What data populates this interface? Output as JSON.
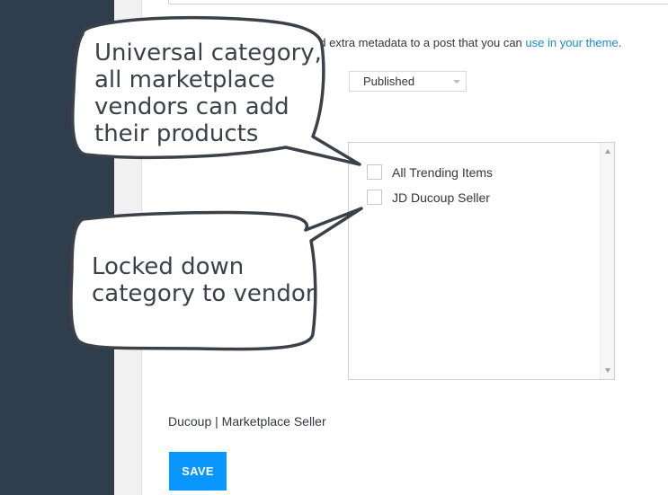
{
  "colors": {
    "sidebar": "#2f3d4c",
    "link": "#1e88d6",
    "save_button": "#0a96ff",
    "callout_border": "#3b4148"
  },
  "metadata_hint": {
    "prefix": "o add extra metadata to a post that you can ",
    "link": "use in your theme",
    "suffix": "."
  },
  "status_select": {
    "value": "Published",
    "icon": "chevron-down-icon"
  },
  "categories": [
    {
      "label": "All Trending Items",
      "checked": false
    },
    {
      "label": "JD Ducoup Seller",
      "checked": false
    }
  ],
  "vendor_label": "Ducoup | Marketplace Seller",
  "save_label": "SAVE",
  "callouts": [
    {
      "lines": [
        "Universal category,",
        "all marketplace",
        "vendors can add",
        "their products"
      ]
    },
    {
      "lines": [
        "Locked down",
        "category to vendor"
      ]
    }
  ]
}
